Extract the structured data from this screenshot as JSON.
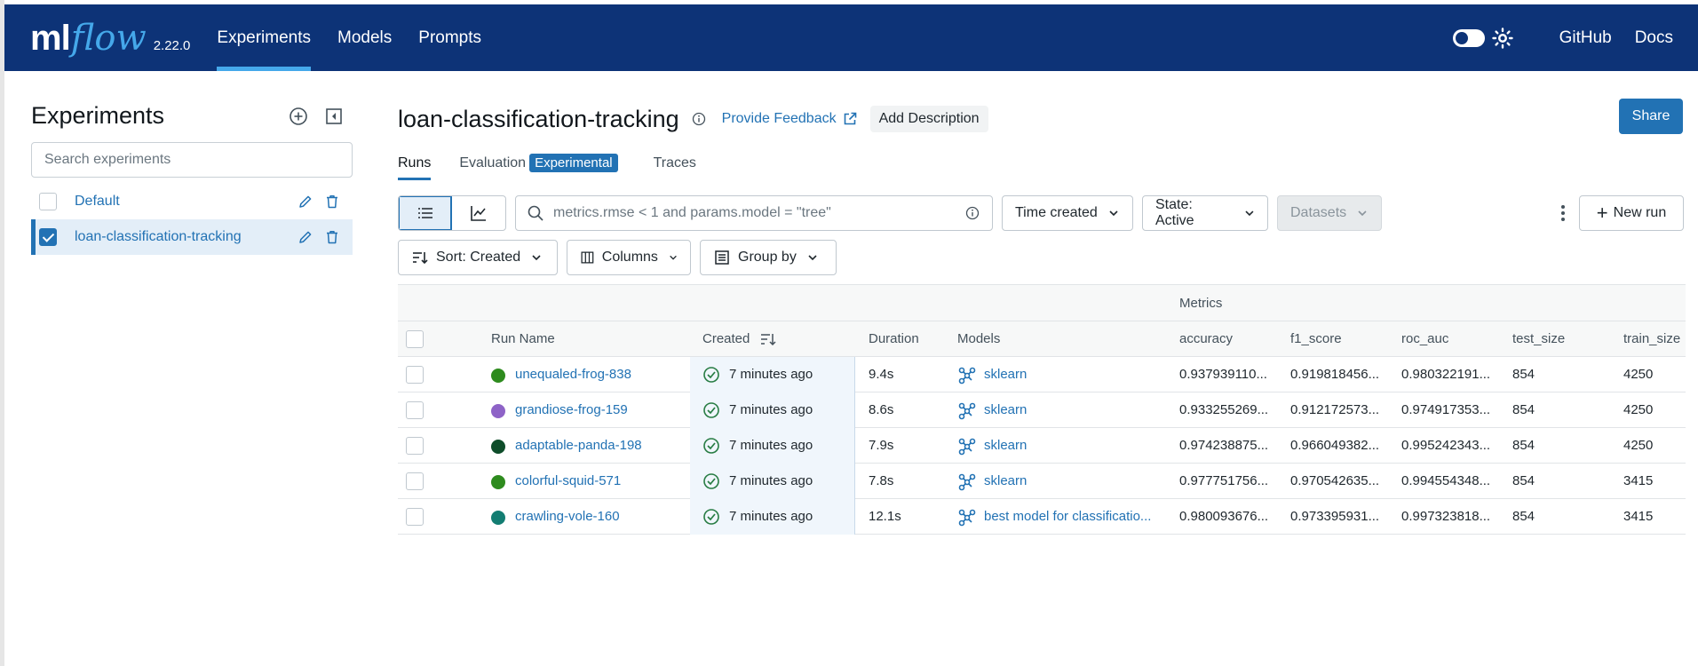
{
  "header": {
    "logo_ml": "ml",
    "logo_flow": "flow",
    "version": "2.22.0",
    "nav": [
      {
        "label": "Experiments"
      },
      {
        "label": "Models"
      },
      {
        "label": "Prompts"
      }
    ],
    "links": [
      {
        "label": "GitHub"
      },
      {
        "label": "Docs"
      }
    ]
  },
  "sidebar": {
    "title": "Experiments",
    "search_placeholder": "Search experiments",
    "experiments": [
      {
        "name": "Default",
        "checked": false
      },
      {
        "name": "loan-classification-tracking",
        "checked": true
      }
    ]
  },
  "main": {
    "title": "loan-classification-tracking",
    "feedback_label": "Provide Feedback",
    "add_description_label": "Add Description",
    "share_label": "Share",
    "tabs": [
      {
        "label": "Runs"
      },
      {
        "label": "Evaluation"
      },
      {
        "label": "Experimental"
      },
      {
        "label": "Traces"
      }
    ],
    "filter_placeholder": "metrics.rmse < 1 and params.model = \"tree\"",
    "time_created_label": "Time created",
    "state_label": "State: Active",
    "datasets_label": "Datasets",
    "new_run_label": "New run",
    "sort_label": "Sort: Created",
    "columns_label": "Columns",
    "group_by_label": "Group by"
  },
  "table": {
    "group_label": "Metrics",
    "columns": {
      "run_name": "Run Name",
      "created": "Created",
      "duration": "Duration",
      "models": "Models",
      "accuracy": "accuracy",
      "f1_score": "f1_score",
      "roc_auc": "roc_auc",
      "test_size": "test_size",
      "train_size": "train_size"
    },
    "rows": [
      {
        "name": "unequaled-frog-838",
        "dot": "#2e8b1e",
        "created": "7 minutes ago",
        "duration": "9.4s",
        "model": "sklearn",
        "accuracy": "0.937939110...",
        "f1": "0.919818456...",
        "roc": "0.980322191...",
        "test": "854",
        "train": "4250"
      },
      {
        "name": "grandiose-frog-159",
        "dot": "#8e63c7",
        "created": "7 minutes ago",
        "duration": "8.6s",
        "model": "sklearn",
        "accuracy": "0.933255269...",
        "f1": "0.912172573...",
        "roc": "0.974917353...",
        "test": "854",
        "train": "4250"
      },
      {
        "name": "adaptable-panda-198",
        "dot": "#0e4d2a",
        "created": "7 minutes ago",
        "duration": "7.9s",
        "model": "sklearn",
        "accuracy": "0.974238875...",
        "f1": "0.966049382...",
        "roc": "0.995242343...",
        "test": "854",
        "train": "4250"
      },
      {
        "name": "colorful-squid-571",
        "dot": "#2e8b1e",
        "created": "7 minutes ago",
        "duration": "7.8s",
        "model": "sklearn",
        "accuracy": "0.977751756...",
        "f1": "0.970542635...",
        "roc": "0.994554348...",
        "test": "854",
        "train": "3415"
      },
      {
        "name": "crawling-vole-160",
        "dot": "#137d72",
        "created": "7 minutes ago",
        "duration": "12.1s",
        "model": "best model for classificatio...",
        "accuracy": "0.980093676...",
        "f1": "0.973395931...",
        "roc": "0.997323818...",
        "test": "854",
        "train": "3415"
      }
    ]
  },
  "colors": {
    "header_bg": "#0d3377",
    "accent": "#2272b4",
    "link": "#2272b4"
  }
}
